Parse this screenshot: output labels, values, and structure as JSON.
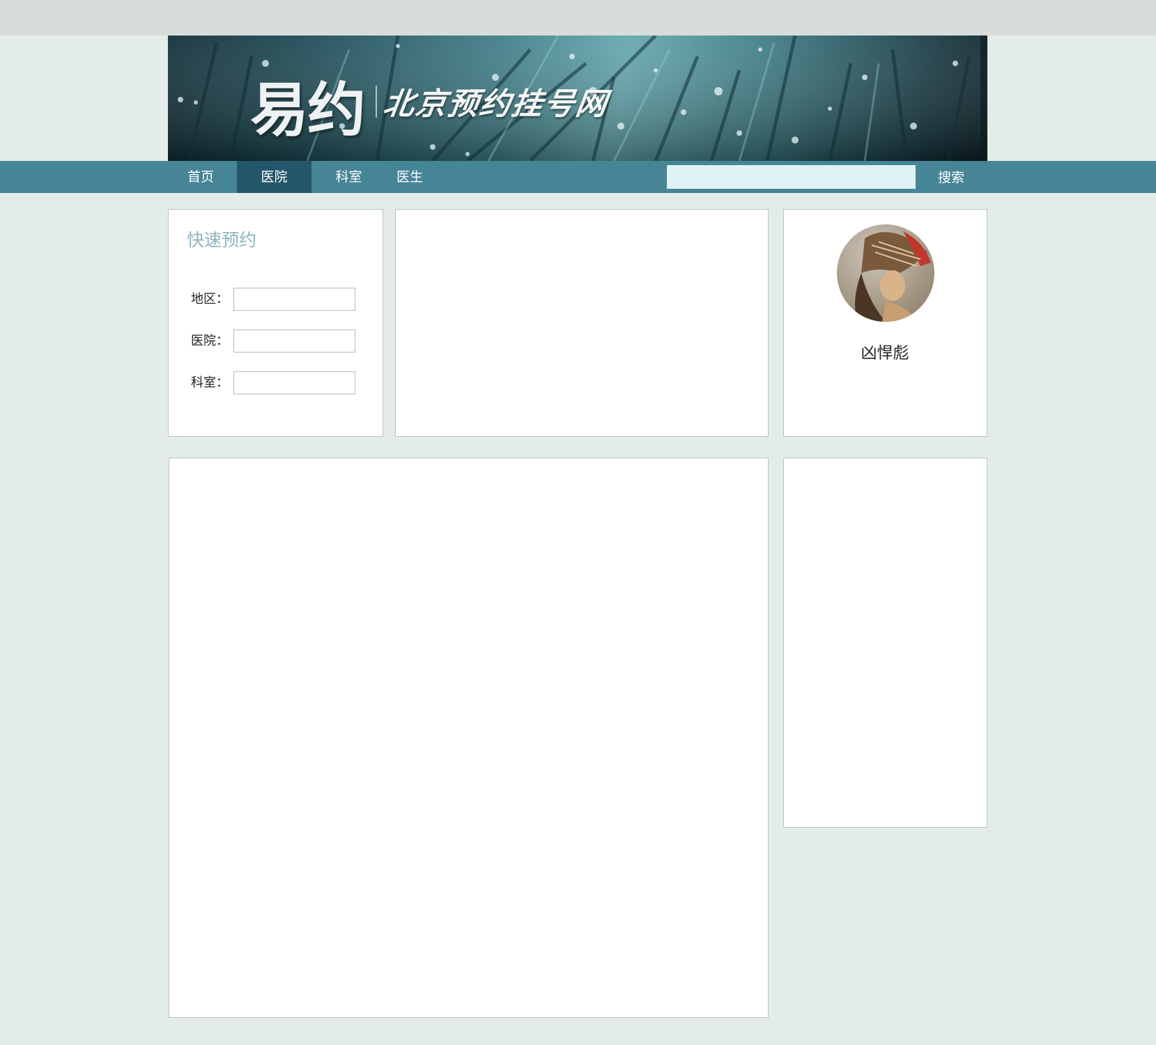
{
  "header": {
    "logo_main": "易约",
    "logo_sub": "北京预约挂号网"
  },
  "nav": {
    "items": [
      {
        "label": "首页",
        "active": false
      },
      {
        "label": "医院",
        "active": true
      },
      {
        "label": "科室",
        "active": false
      },
      {
        "label": "医生",
        "active": false
      }
    ],
    "search": {
      "value": "",
      "placeholder": "",
      "button_label": "搜索"
    }
  },
  "quick_booking": {
    "title": "快速预约",
    "fields": [
      {
        "label": "地区：",
        "value": ""
      },
      {
        "label": "医院：",
        "value": ""
      },
      {
        "label": "科室：",
        "value": ""
      }
    ]
  },
  "user": {
    "name": "凶悍彪"
  },
  "colors": {
    "page_bg": "#e3ece8",
    "topbar": "#d7dcdc",
    "nav_bg": "#468596",
    "nav_active": "#24576a",
    "search_bg": "#e0f2f4",
    "accent_title": "#8bb4bf"
  }
}
